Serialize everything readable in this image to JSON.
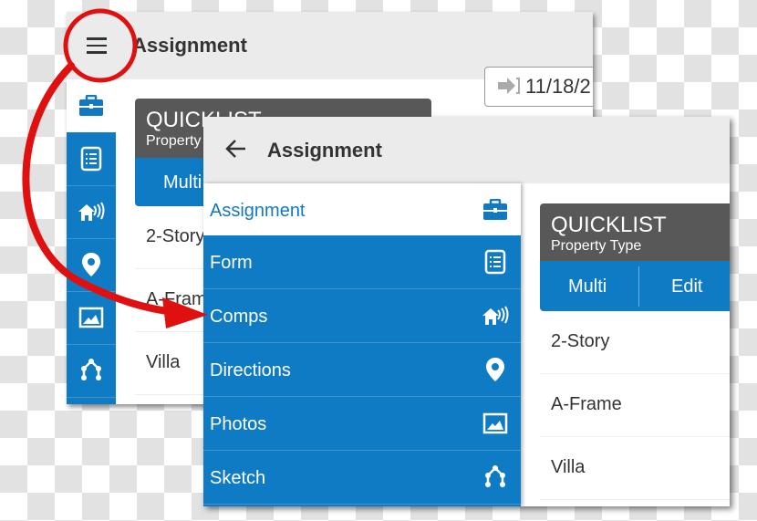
{
  "back_screen": {
    "title": "Assignment",
    "menu_icon": "hamburger-menu-icon",
    "date": "11/18/2",
    "date_icon": "sign-in-arrow-icon",
    "rail_icons": [
      "briefcase-icon",
      "form-list-icon",
      "comps-houses-icon",
      "location-pin-icon",
      "photo-icon",
      "sketch-icon"
    ],
    "quicklist": {
      "title": "QUICKLIST",
      "subtitle": "Property",
      "multi_label": "Multi"
    },
    "list": [
      "2-Story",
      "A-Frame",
      "Villa"
    ]
  },
  "front_screen": {
    "title": "Assignment",
    "back_icon": "back-arrow-icon",
    "drawer": [
      {
        "label": "Assignment",
        "icon": "briefcase-icon",
        "active": true
      },
      {
        "label": "Form",
        "icon": "form-list-icon"
      },
      {
        "label": "Comps",
        "icon": "comps-houses-icon"
      },
      {
        "label": "Directions",
        "icon": "location-pin-icon"
      },
      {
        "label": "Photos",
        "icon": "photo-icon"
      },
      {
        "label": "Sketch",
        "icon": "sketch-icon"
      }
    ],
    "quicklist": {
      "title": "QUICKLIST",
      "subtitle": "Property Type",
      "multi_label": "Multi",
      "edit_label": "Edit"
    },
    "list": [
      "2-Story",
      "A-Frame",
      "Villa"
    ]
  },
  "colors": {
    "primary": "#0f7bc4",
    "header_gray": "#585858",
    "appbar": "#ebebeb",
    "annotation_red": "#e01010"
  }
}
